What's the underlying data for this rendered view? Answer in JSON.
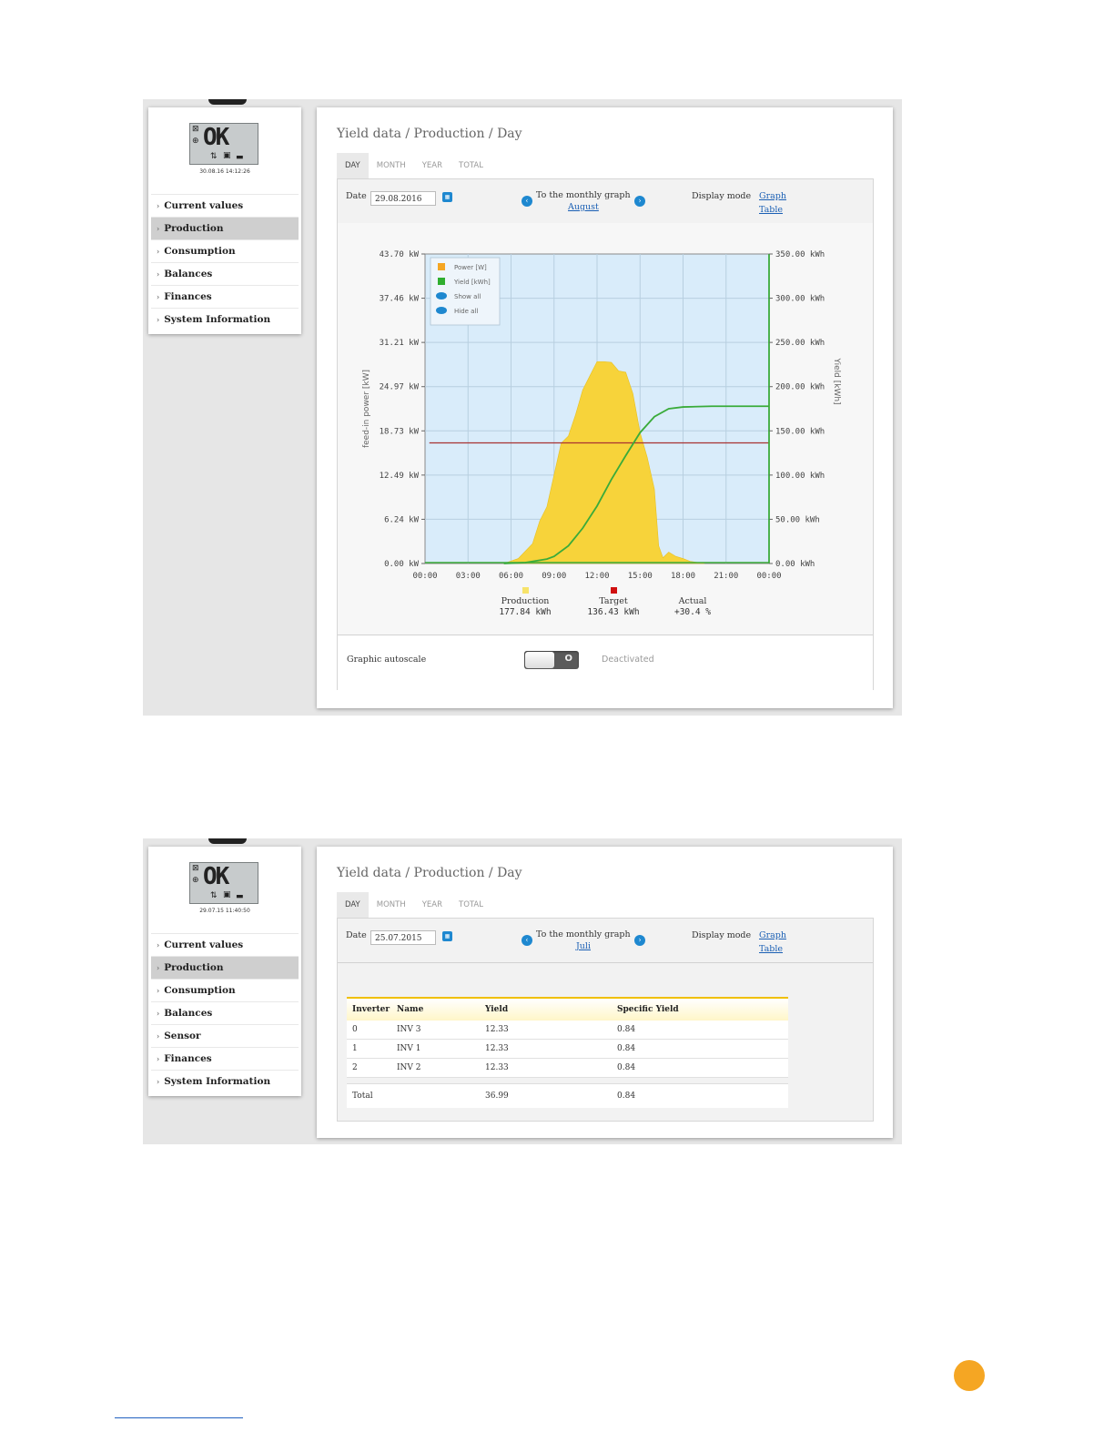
{
  "screens": [
    {
      "lcd": {
        "text": "OK",
        "timestamp": "30.08.16 14:12:26"
      },
      "sidebar": [
        "Current values",
        "Production",
        "Consumption",
        "Balances",
        "Finances",
        "System Information"
      ],
      "active_nav": "Production",
      "title": "Yield data / Production / Day",
      "tabs": [
        "DAY",
        "MONTH",
        "YEAR",
        "TOTAL"
      ],
      "active_tab": "DAY",
      "toolbar": {
        "date_label": "Date",
        "date_value": "29.08.2016",
        "monthly_graph": "To the monthly graph",
        "month_link": "August",
        "display_mode": "Display mode",
        "graph": "Graph",
        "table": "Table"
      },
      "autoscale": {
        "label": "Graphic autoscale",
        "state": "Deactivated",
        "toggle_glyph": "O"
      }
    },
    {
      "lcd": {
        "text": "OK",
        "timestamp": "29.07.15 11:40:50"
      },
      "sidebar": [
        "Current values",
        "Production",
        "Consumption",
        "Balances",
        "Sensor",
        "Finances",
        "System Information"
      ],
      "active_nav": "Production",
      "title": "Yield data / Production / Day",
      "tabs": [
        "DAY",
        "MONTH",
        "YEAR",
        "TOTAL"
      ],
      "active_tab": "DAY",
      "toolbar": {
        "date_label": "Date",
        "date_value": "25.07.2015",
        "monthly_graph": "To the monthly graph",
        "month_link": "Juli",
        "display_mode": "Display mode",
        "graph": "Graph",
        "table": "Table"
      },
      "table": {
        "headers": [
          "Inverter",
          "Name",
          "Yield",
          "Specific Yield"
        ],
        "rows": [
          [
            "0",
            "INV 3",
            "12.33",
            "0.84"
          ],
          [
            "1",
            "INV 1",
            "12.33",
            "0.84"
          ],
          [
            "2",
            "INV 2",
            "12.33",
            "0.84"
          ]
        ],
        "total": {
          "label": "Total",
          "yield": "36.99",
          "specific": "0.84"
        }
      }
    }
  ],
  "chart_data": {
    "type": "line",
    "left_ylabel": "feed-in power [kW]",
    "right_ylabel": "Yield [kWh]",
    "left_ticks": [
      "43.70 kW",
      "37.46 kW",
      "31.21 kW",
      "24.97 kW",
      "18.73 kW",
      "12.49 kW",
      "6.24 kW",
      "0.00 kW"
    ],
    "right_ticks": [
      "350.00 kWh",
      "300.00 kWh",
      "250.00 kWh",
      "200.00 kWh",
      "150.00 kWh",
      "100.00 kWh",
      "50.00 kWh",
      "0.00 kWh"
    ],
    "x_ticks": [
      "00:00",
      "03:00",
      "06:00",
      "09:00",
      "12:00",
      "15:00",
      "18:00",
      "21:00",
      "00:00"
    ],
    "ylim_left": [
      0,
      43.7
    ],
    "ylim_right": [
      0,
      350
    ],
    "xlim": [
      0,
      24
    ],
    "grid": true,
    "legend_position": "top-left",
    "legend": [
      "Power [W]",
      "Yield [kWh]",
      "Show all",
      "Hide all"
    ],
    "colors": {
      "power": "#f7d33a",
      "yield": "#3aab3a",
      "target": "#a83232",
      "plot_bg": "#d9ecfa"
    },
    "series": [
      {
        "name": "Power [W]",
        "x": [
          5.5,
          6.5,
          7.5,
          8.0,
          8.5,
          9.0,
          9.5,
          10.0,
          10.5,
          11.0,
          11.5,
          12.0,
          12.5,
          13.0,
          13.5,
          14.0,
          14.5,
          15.0,
          15.5,
          16.0,
          16.3,
          16.6,
          17.0,
          17.5,
          18.0,
          18.5,
          19.5
        ],
        "y": [
          0.0,
          0.7,
          2.8,
          6.0,
          8.0,
          12.5,
          17.0,
          18.0,
          21.0,
          24.5,
          26.5,
          28.5,
          28.5,
          28.4,
          27.2,
          27.0,
          24.0,
          18.5,
          15.0,
          10.5,
          2.5,
          0.8,
          1.6,
          1.0,
          0.7,
          0.3,
          0.0
        ]
      },
      {
        "name": "Yield [kWh]",
        "x": [
          5.5,
          7.0,
          8.5,
          9.0,
          10.0,
          11.0,
          12.0,
          13.0,
          14.0,
          15.0,
          16.0,
          17.0,
          18.0,
          20.0,
          24.0
        ],
        "y": [
          0,
          1,
          5,
          8,
          20,
          40,
          65,
          95,
          122,
          148,
          166,
          175,
          177,
          177.84,
          177.84
        ]
      },
      {
        "name": "Target",
        "x": [
          0.3,
          24
        ],
        "y": [
          136.43,
          136.43
        ]
      }
    ],
    "summary": [
      {
        "label": "Production",
        "value": "177.84 kWh",
        "color": "#f7e36a"
      },
      {
        "label": "Target",
        "value": "136.43 kWh",
        "color": "#d01010"
      },
      {
        "label": "Actual",
        "value": "+30.4 %",
        "color": ""
      }
    ]
  }
}
